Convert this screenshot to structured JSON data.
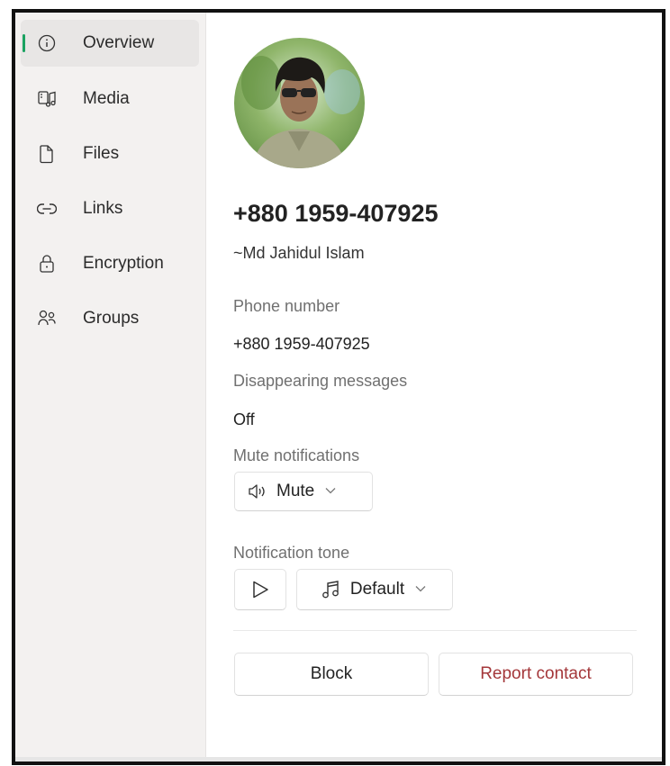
{
  "sidebar": {
    "items": [
      {
        "label": "Overview",
        "icon": "info-icon",
        "active": true
      },
      {
        "label": "Media",
        "icon": "media-icon",
        "active": false
      },
      {
        "label": "Files",
        "icon": "file-icon",
        "active": false
      },
      {
        "label": "Links",
        "icon": "link-icon",
        "active": false
      },
      {
        "label": "Encryption",
        "icon": "lock-icon",
        "active": false
      },
      {
        "label": "Groups",
        "icon": "people-icon",
        "active": false
      }
    ]
  },
  "contact": {
    "title": "+880 1959-407925",
    "display_name": "~Md Jahidul Islam"
  },
  "fields": {
    "phone_label": "Phone number",
    "phone_value": "+880 1959-407925",
    "disappearing_label": "Disappearing messages",
    "disappearing_value": "Off",
    "mute_label": "Mute notifications",
    "mute_button": "Mute",
    "tone_label": "Notification tone",
    "tone_value": "Default"
  },
  "actions": {
    "block_label": "Block",
    "report_label": "Report contact"
  },
  "colors": {
    "accent": "#1aa260",
    "danger_text": "#a4373a"
  }
}
